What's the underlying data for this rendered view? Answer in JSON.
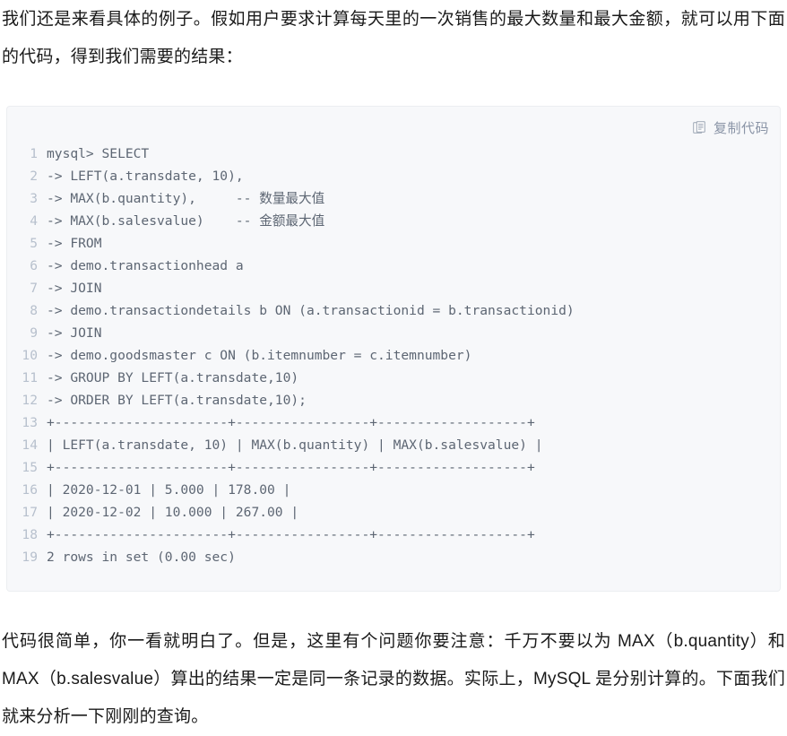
{
  "article": {
    "intro_paragraph": "我们还是来看具体的例子。假如用户要求计算每天里的一次销售的最大数量和最大金额，就可以用下面的代码，得到我们需要的结果：",
    "outro_paragraph": "代码很简单，你一看就明白了。但是，这里有个问题你要注意：千万不要以为 MAX（b.quantity）和 MAX（b.salesvalue）算出的结果一定是同一条记录的数据。实际上，MySQL 是分别计算的。下面我们就来分析一下刚刚的查询。"
  },
  "code_block": {
    "copy_button_label": "复制代码",
    "copy_button_icon": "copy-document-icon",
    "background_color": "#f7f8fa",
    "line_number_color": "#b7c0cd",
    "code_text_color": "#5d6673",
    "lines": [
      {
        "n": "1",
        "text": "mysql> SELECT"
      },
      {
        "n": "2",
        "text": "-> LEFT(a.transdate, 10),"
      },
      {
        "n": "3",
        "text": "-> MAX(b.quantity),     -- 数量最大值"
      },
      {
        "n": "4",
        "text": "-> MAX(b.salesvalue)    -- 金额最大值"
      },
      {
        "n": "5",
        "text": "-> FROM"
      },
      {
        "n": "6",
        "text": "-> demo.transactionhead a"
      },
      {
        "n": "7",
        "text": "-> JOIN"
      },
      {
        "n": "8",
        "text": "-> demo.transactiondetails b ON (a.transactionid = b.transactionid)"
      },
      {
        "n": "9",
        "text": "-> JOIN"
      },
      {
        "n": "10",
        "text": "-> demo.goodsmaster c ON (b.itemnumber = c.itemnumber)"
      },
      {
        "n": "11",
        "text": "-> GROUP BY LEFT(a.transdate,10)"
      },
      {
        "n": "12",
        "text": "-> ORDER BY LEFT(a.transdate,10);"
      },
      {
        "n": "13",
        "text": "+----------------------+-----------------+-------------------+"
      },
      {
        "n": "14",
        "text": "| LEFT(a.transdate, 10) | MAX(b.quantity) | MAX(b.salesvalue) |"
      },
      {
        "n": "15",
        "text": "+----------------------+-----------------+-------------------+"
      },
      {
        "n": "16",
        "text": "| 2020-12-01 | 5.000 | 178.00 |"
      },
      {
        "n": "17",
        "text": "| 2020-12-02 | 10.000 | 267.00 |"
      },
      {
        "n": "18",
        "text": "+----------------------+-----------------+-------------------+"
      },
      {
        "n": "19",
        "text": "2 rows in set (0.00 sec)"
      }
    ]
  },
  "result_table": {
    "columns": [
      "LEFT(a.transdate, 10)",
      "MAX(b.quantity)",
      "MAX(b.salesvalue)"
    ],
    "rows": [
      [
        "2020-12-01",
        "5.000",
        "178.00"
      ],
      [
        "2020-12-02",
        "10.000",
        "267.00"
      ]
    ],
    "footer": "2 rows in set (0.00 sec)"
  }
}
